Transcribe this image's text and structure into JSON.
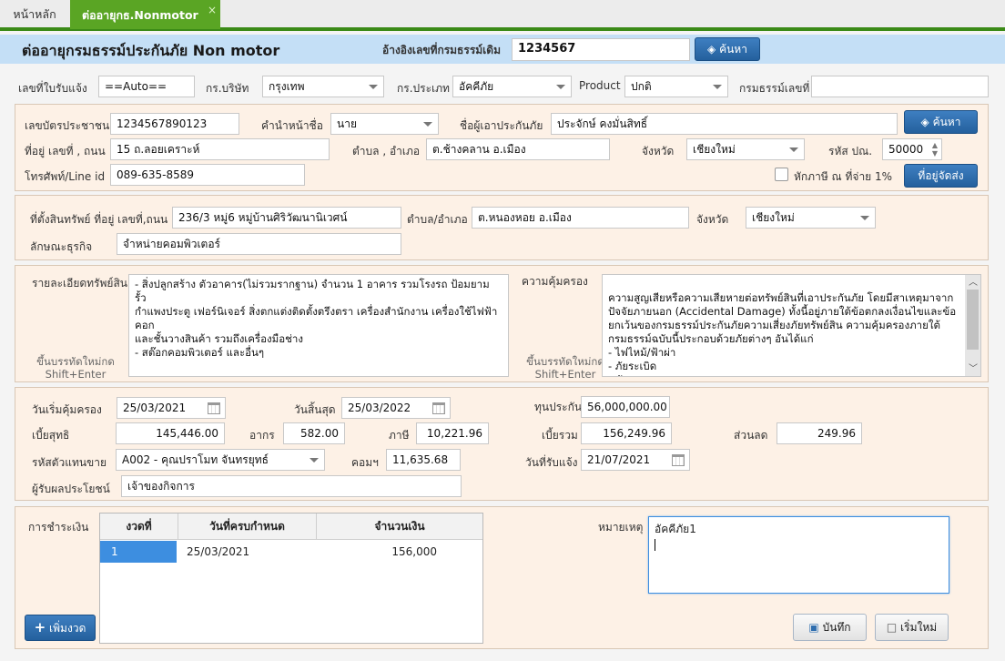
{
  "tabs": {
    "home": "หน้าหลัก",
    "active": "ต่ออายุกธ.Nonmotor",
    "close": "×"
  },
  "header": {
    "title": "ต่ออายุกรมธรรม์ประกันภัย Non motor",
    "ref_label": "อ้างอิงเลขที่กรมธรรม์เดิม",
    "ref_value": "1234567",
    "search_label": "ค้นหา"
  },
  "policy_row": {
    "receipt_label": "เลขที่ใบรับแจ้ง",
    "receipt_value": "==Auto==",
    "company_label": "กร.บริษัท",
    "company_value": "กรุงเทพ",
    "type_label": "กร.ประเภท",
    "type_value": "อัคคีภัย",
    "product_label": "Product",
    "product_value": "ปกติ",
    "policy_no_label": "กรมธรรม์เลขที่",
    "policy_no_value": ""
  },
  "customer": {
    "id_label": "เลขบัตรประชาชน",
    "id_value": "1234567890123",
    "prefix_label": "คำนำหน้าชื่อ",
    "prefix_value": "นาย",
    "name_label": "ชื่อผู้เอาประกันภัย",
    "name_value": "ประจักษ์ คงมั่นสิทธิ์",
    "search_label": "ค้นหา",
    "address_label": "ที่อยู่ เลขที่ , ถนน",
    "address_value": "15 ถ.ลอยเคราะห์",
    "subdistrict_label": "ตำบล , อำเภอ",
    "subdistrict_value": "ต.ช้างคลาน อ.เมือง",
    "province_label": "จังหวัด",
    "province_value": "เชียงใหม่",
    "postcode_label": "รหัส ปณ.",
    "postcode_value": "50000",
    "phone_label": "โทรศัพท์/Line id",
    "phone_value": "089-635-8589",
    "withholding_label": "หักภาษี ณ ที่จ่าย 1%",
    "delivery_address_label": "ที่อยู่จัดส่ง"
  },
  "property": {
    "location_label": "ที่ตั้งสินทรัพย์ ที่อยู่ เลขที่,ถนน",
    "location_value": "236/3 หมู่6 หมู่บ้านศิริวัฒนานิเวศน์",
    "subdistrict_label": "ตำบล/อำเภอ",
    "subdistrict_value": "ต.หนองหอย อ.เมือง",
    "province_label": "จังหวัด",
    "province_value": "เชียงใหม่",
    "business_label": "ลักษณะธุรกิจ",
    "business_value": "จำหน่ายคอมพิวเตอร์"
  },
  "details": {
    "asset_label": "รายละเอียดทรัพย์สิน",
    "asset_text": "- สิ่งปลูกสร้าง ตัวอาคาร(ไม่รวมรากฐาน) จำนวน 1 อาคาร รวมโรงรถ ป้อมยาม รั้ว\nกำแพงประตู เฟอร์นิเจอร์ สิ่งตกแต่งติดตั้งตรึงตรา เครื่องสำนักงาน เครื่องใช้ไฟฟ้าคอก\nและชั้นวางสินค้า รวมถึงเครื่องมือช่าง\n- สต๊อกคอมพิวเตอร์ และอื่นๆ",
    "coverage_label": "ความคุ้มครอง",
    "coverage_text": "ความสูญเสียหรือความเสียหายต่อทรัพย์สินที่เอาประกันภัย โดยมีสาเหตุมาจาก\nปัจจัยภายนอก (Accidental Damage) ทั้งนี้อยู่ภายใต้ข้อตกลงเงื่อนไขและข้อ\nยกเว้นของกรมธรรม์ประกันภัยความเสี่ยงภัยทรัพย์สิน ความคุ้มครองภายใต้\nกรมธรรม์ฉบับนี้ประกอบด้วยภัยต่างๆ อันได้แก่\n- ไฟไหม้/ฟ้าผ่า\n- ภัยระเบิด\n- ภัยทางอากาศ",
    "hint_line1": "ขึ้นบรรทัดใหม่กด",
    "hint_line2": "Shift+Enter"
  },
  "premium": {
    "start_label": "วันเริ่มคุ้มครอง",
    "start_value": "25/03/2021",
    "end_label": "วันสิ้นสุด",
    "end_value": "25/03/2022",
    "sum_label": "ทุนประกัน",
    "sum_value": "56,000,000.00",
    "net_label": "เบี้ยสุทธิ",
    "net_value": "145,446.00",
    "stamp_label": "อากร",
    "stamp_value": "582.00",
    "tax_label": "ภาษี",
    "tax_value": "10,221.96",
    "total_label": "เบี้ยรวม",
    "total_value": "156,249.96",
    "discount_label": "ส่วนลด",
    "discount_value": "249.96",
    "agent_label": "รหัสตัวแทนขาย",
    "agent_value": "A002 - คุณปราโมท จันทรยุทธ์",
    "commission_label": "คอมฯ",
    "commission_value": "11,635.68",
    "notify_label": "วันที่รับแจ้ง",
    "notify_value": "21/07/2021",
    "beneficiary_label": "ผู้รับผลประโยชน์",
    "beneficiary_value": "เจ้าของกิจการ"
  },
  "payment": {
    "label": "การชำระเงิน",
    "columns": [
      "งวดที่",
      "วันที่ครบกำหนด",
      "จำนวนเงิน"
    ],
    "rows": [
      {
        "installment": "1",
        "due": "25/03/2021",
        "amount": "156,000"
      }
    ],
    "add_label": "เพิ่มงวด",
    "remark_label": "หมายเหตุ",
    "remark_value": "อัคคีภัย1",
    "save_label": "บันทึก",
    "new_label": "เริ่มใหม่"
  },
  "colors": {
    "accent_green": "#5aa524",
    "header_blue": "#c4dff6",
    "panel_bg": "#fdf1e6",
    "button_blue": "#2f6eaf",
    "selection_blue": "#3d8ee0"
  }
}
